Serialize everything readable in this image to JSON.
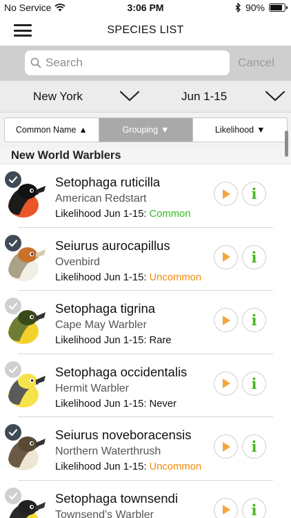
{
  "status_bar": {
    "carrier": "No Service",
    "time": "3:06 PM",
    "battery": "90%",
    "battery_level": 0.9,
    "icons": [
      "wifi-icon",
      "bluetooth-icon",
      "battery-icon"
    ]
  },
  "nav": {
    "title": "SPECIES LIST",
    "menu_icon": "hamburger-menu-icon"
  },
  "search": {
    "placeholder": "Search",
    "value": "",
    "cancel_label": "Cancel"
  },
  "filters": {
    "region": "New York",
    "date_range": "Jun 1-15"
  },
  "sort": {
    "options": [
      {
        "label": "Common Name",
        "arrow": "▲"
      },
      {
        "label": "Grouping",
        "arrow": "▼"
      },
      {
        "label": "Likelihood",
        "arrow": "▼"
      }
    ],
    "active_index": 1
  },
  "list": {
    "group_name": "New World Warblers",
    "items": [
      {
        "scientific": "Setophaga ruticilla",
        "common": "American Redstart",
        "likelihood_label": "Likelihood Jun 1-15:",
        "likelihood": "Common",
        "checked": true
      },
      {
        "scientific": "Seiurus aurocapillus",
        "common": "Ovenbird",
        "likelihood_label": "Likelihood Jun 1-15:",
        "likelihood": "Uncommon",
        "checked": true
      },
      {
        "scientific": "Setophaga tigrina",
        "common": "Cape May Warbler",
        "likelihood_label": "Likelihood Jun 1-15:",
        "likelihood": "Rare",
        "checked": false
      },
      {
        "scientific": "Setophaga occidentalis",
        "common": "Hermit Warbler",
        "likelihood_label": "Likelihood Jun 1-15:",
        "likelihood": "Never",
        "checked": false
      },
      {
        "scientific": "Seiurus noveboracensis",
        "common": "Northern Waterthrush",
        "likelihood_label": "Likelihood Jun 1-15:",
        "likelihood": "Uncommon",
        "checked": true
      },
      {
        "scientific": "Setophaga townsendi",
        "common": "Townsend's Warbler",
        "likelihood_label": "",
        "likelihood": "",
        "checked": false
      }
    ]
  },
  "colors": {
    "common": "#2fbf1f",
    "uncommon": "#f08a0c",
    "rare": "#111111",
    "never": "#111111",
    "play": "#f4a53b",
    "info": "#46b81c"
  }
}
